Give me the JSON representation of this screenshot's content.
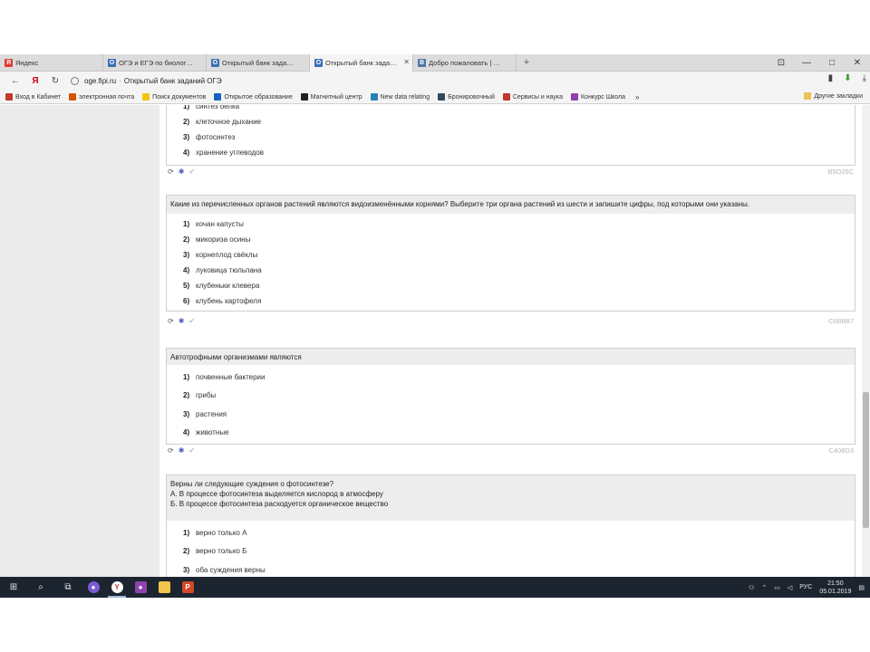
{
  "tabs": [
    {
      "label": "Яндекс",
      "fav": "Я",
      "color": "#e53935"
    },
    {
      "label": "ОГЭ и ЕГЭ по биологии",
      "fav": "О",
      "color": "#3d6fb6"
    },
    {
      "label": "Открытый банк заданий ОГЭ",
      "fav": "О",
      "color": "#3d6fb6"
    },
    {
      "label": "Открытый банк заданий",
      "fav": "О",
      "color": "#3d6fb6",
      "active": true
    },
    {
      "label": "Добро пожаловать | ВКонтакте",
      "fav": "В",
      "color": "#4a76a8"
    }
  ],
  "address": {
    "host": "oge.fipi.ru",
    "title": "Открытый банк заданий ОГЭ"
  },
  "bookmarks": [
    {
      "label": "Вход в Кабинет",
      "color": "#c0392b"
    },
    {
      "label": "электронная почта",
      "color": "#d35400"
    },
    {
      "label": "Поиск документов",
      "color": "#f1c40f"
    },
    {
      "label": "Открытое образование",
      "color": "#1565c0"
    },
    {
      "label": "Магнитный центр",
      "color": "#222222"
    },
    {
      "label": "New data relating",
      "color": "#2980b9"
    },
    {
      "label": "Бронировочный",
      "color": "#34495e"
    },
    {
      "label": "Сервисы и наука",
      "color": "#c0392b"
    },
    {
      "label": "Конкурс Школа",
      "color": "#8e44ad"
    }
  ],
  "bookmarks_more": "»",
  "bookmarks_other": "Другие закладки",
  "questions": [
    {
      "text": [],
      "answers": [
        {
          "num": "1)",
          "text": "синтез белка"
        },
        {
          "num": "2)",
          "text": "клеточное дыхание"
        },
        {
          "num": "3)",
          "text": "фотосинтез"
        },
        {
          "num": "4)",
          "text": "хранение углеводов"
        }
      ],
      "code": "B5D26C"
    },
    {
      "text": [
        "Какие из перечисленных органов растений являются видоизменёнными корнями? Выберите три органа растений из шести и запишите цифры, под которыми они указаны."
      ],
      "answers": [
        {
          "num": "1)",
          "text": "кочан капусты"
        },
        {
          "num": "2)",
          "text": "микориза осины"
        },
        {
          "num": "3)",
          "text": "корнеплод свёклы"
        },
        {
          "num": "4)",
          "text": "луковица тюльпана"
        },
        {
          "num": "5)",
          "text": "клубеньки клевера"
        },
        {
          "num": "6)",
          "text": "клубень картофеля"
        }
      ],
      "code": "C6BB87"
    },
    {
      "text": [
        "Автотрофными организмами являются"
      ],
      "answers": [
        {
          "num": "1)",
          "text": "почвенные бактерии"
        },
        {
          "num": "2)",
          "text": "грибы"
        },
        {
          "num": "3)",
          "text": "растения"
        },
        {
          "num": "4)",
          "text": "животные"
        }
      ],
      "code": "C408D3"
    },
    {
      "text": [
        "Верны ли следующие суждения о фотосинтезе?",
        "А. В процессе фотосинтеза выделяется кислород в атмосферу",
        "Б. В процессе фотосинтеза расходуется органическое вещество"
      ],
      "answers": [
        {
          "num": "1)",
          "text": "верно только А"
        },
        {
          "num": "2)",
          "text": "верно только Б"
        },
        {
          "num": "3)",
          "text": "оба суждения верны"
        }
      ],
      "code": ""
    }
  ],
  "taskbar": {
    "lang": "РУС",
    "time": "21:50",
    "date": "05.01.2019"
  }
}
